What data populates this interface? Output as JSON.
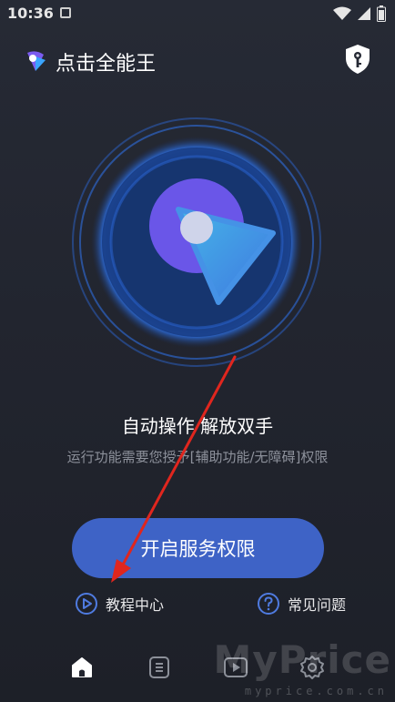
{
  "status_bar": {
    "time": "10:36"
  },
  "header": {
    "title": "点击全能王"
  },
  "main": {
    "headline": "自动操作 解放双手",
    "subline": "运行功能需要您授予[辅助功能/无障碍]权限",
    "enable_button_label": "开启服务权限"
  },
  "links": {
    "tutorial_label": "教程中心",
    "faq_label": "常见问题"
  },
  "bottom_nav": {
    "items": [
      {
        "icon": "home-icon",
        "active": true
      },
      {
        "icon": "list-icon",
        "active": false
      },
      {
        "icon": "video-icon",
        "active": false
      },
      {
        "icon": "gear-icon",
        "active": false
      }
    ]
  },
  "watermark": {
    "main": "MyPrice",
    "sub": "myprice.com.cn"
  },
  "colors": {
    "accent_button": "#3e63c6",
    "background": "#22252f",
    "annotation_arrow": "#e0261e"
  }
}
